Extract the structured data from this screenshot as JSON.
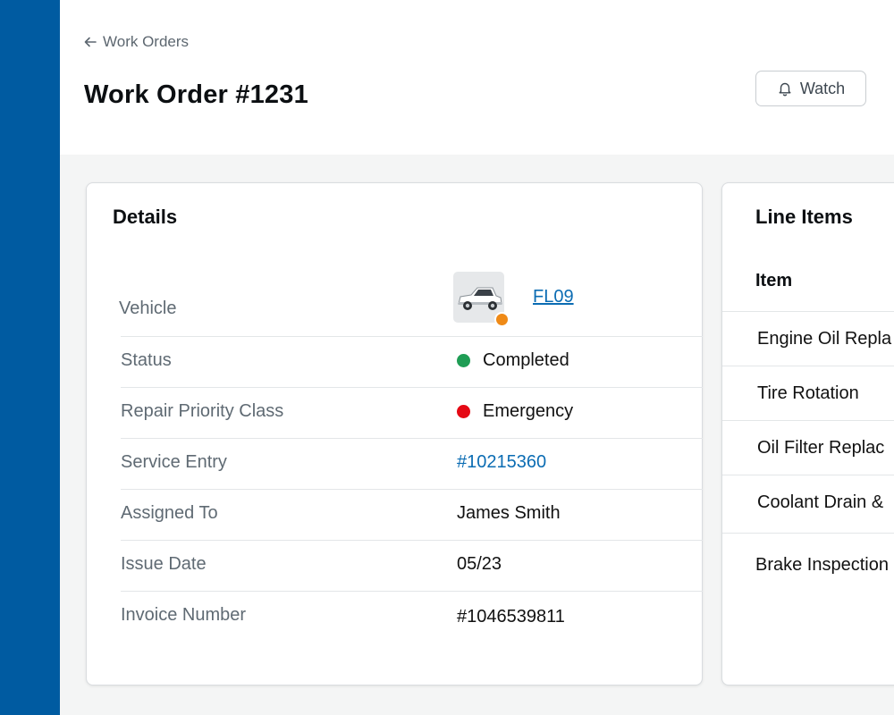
{
  "header": {
    "back_label": "Work Orders",
    "title": "Work Order #1231",
    "watch_label": "Watch"
  },
  "details": {
    "title": "Details",
    "vehicle": {
      "label": "Vehicle",
      "value": "FL09",
      "badge_color": "#ef8a17"
    },
    "status": {
      "label": "Status",
      "value": "Completed",
      "color": "#1f9d55"
    },
    "priority": {
      "label": "Repair Priority Class",
      "value": "Emergency",
      "color": "#e50914"
    },
    "service_entry": {
      "label": "Service Entry",
      "value": "#10215360"
    },
    "assigned_to": {
      "label": "Assigned To",
      "value": "James Smith"
    },
    "issue_date": {
      "label": "Issue Date",
      "value": "05/23"
    },
    "invoice": {
      "label": "Invoice Number",
      "value": "#1046539811"
    }
  },
  "line_items": {
    "title": "Line Items",
    "column_header": "Item",
    "items": [
      "Engine Oil Repla",
      "Tire Rotation",
      "Oil Filter Replac",
      "Coolant Drain &",
      "Brake Inspection"
    ]
  },
  "colors": {
    "sidebar": "#005ba1",
    "link": "#0b6cb3"
  }
}
